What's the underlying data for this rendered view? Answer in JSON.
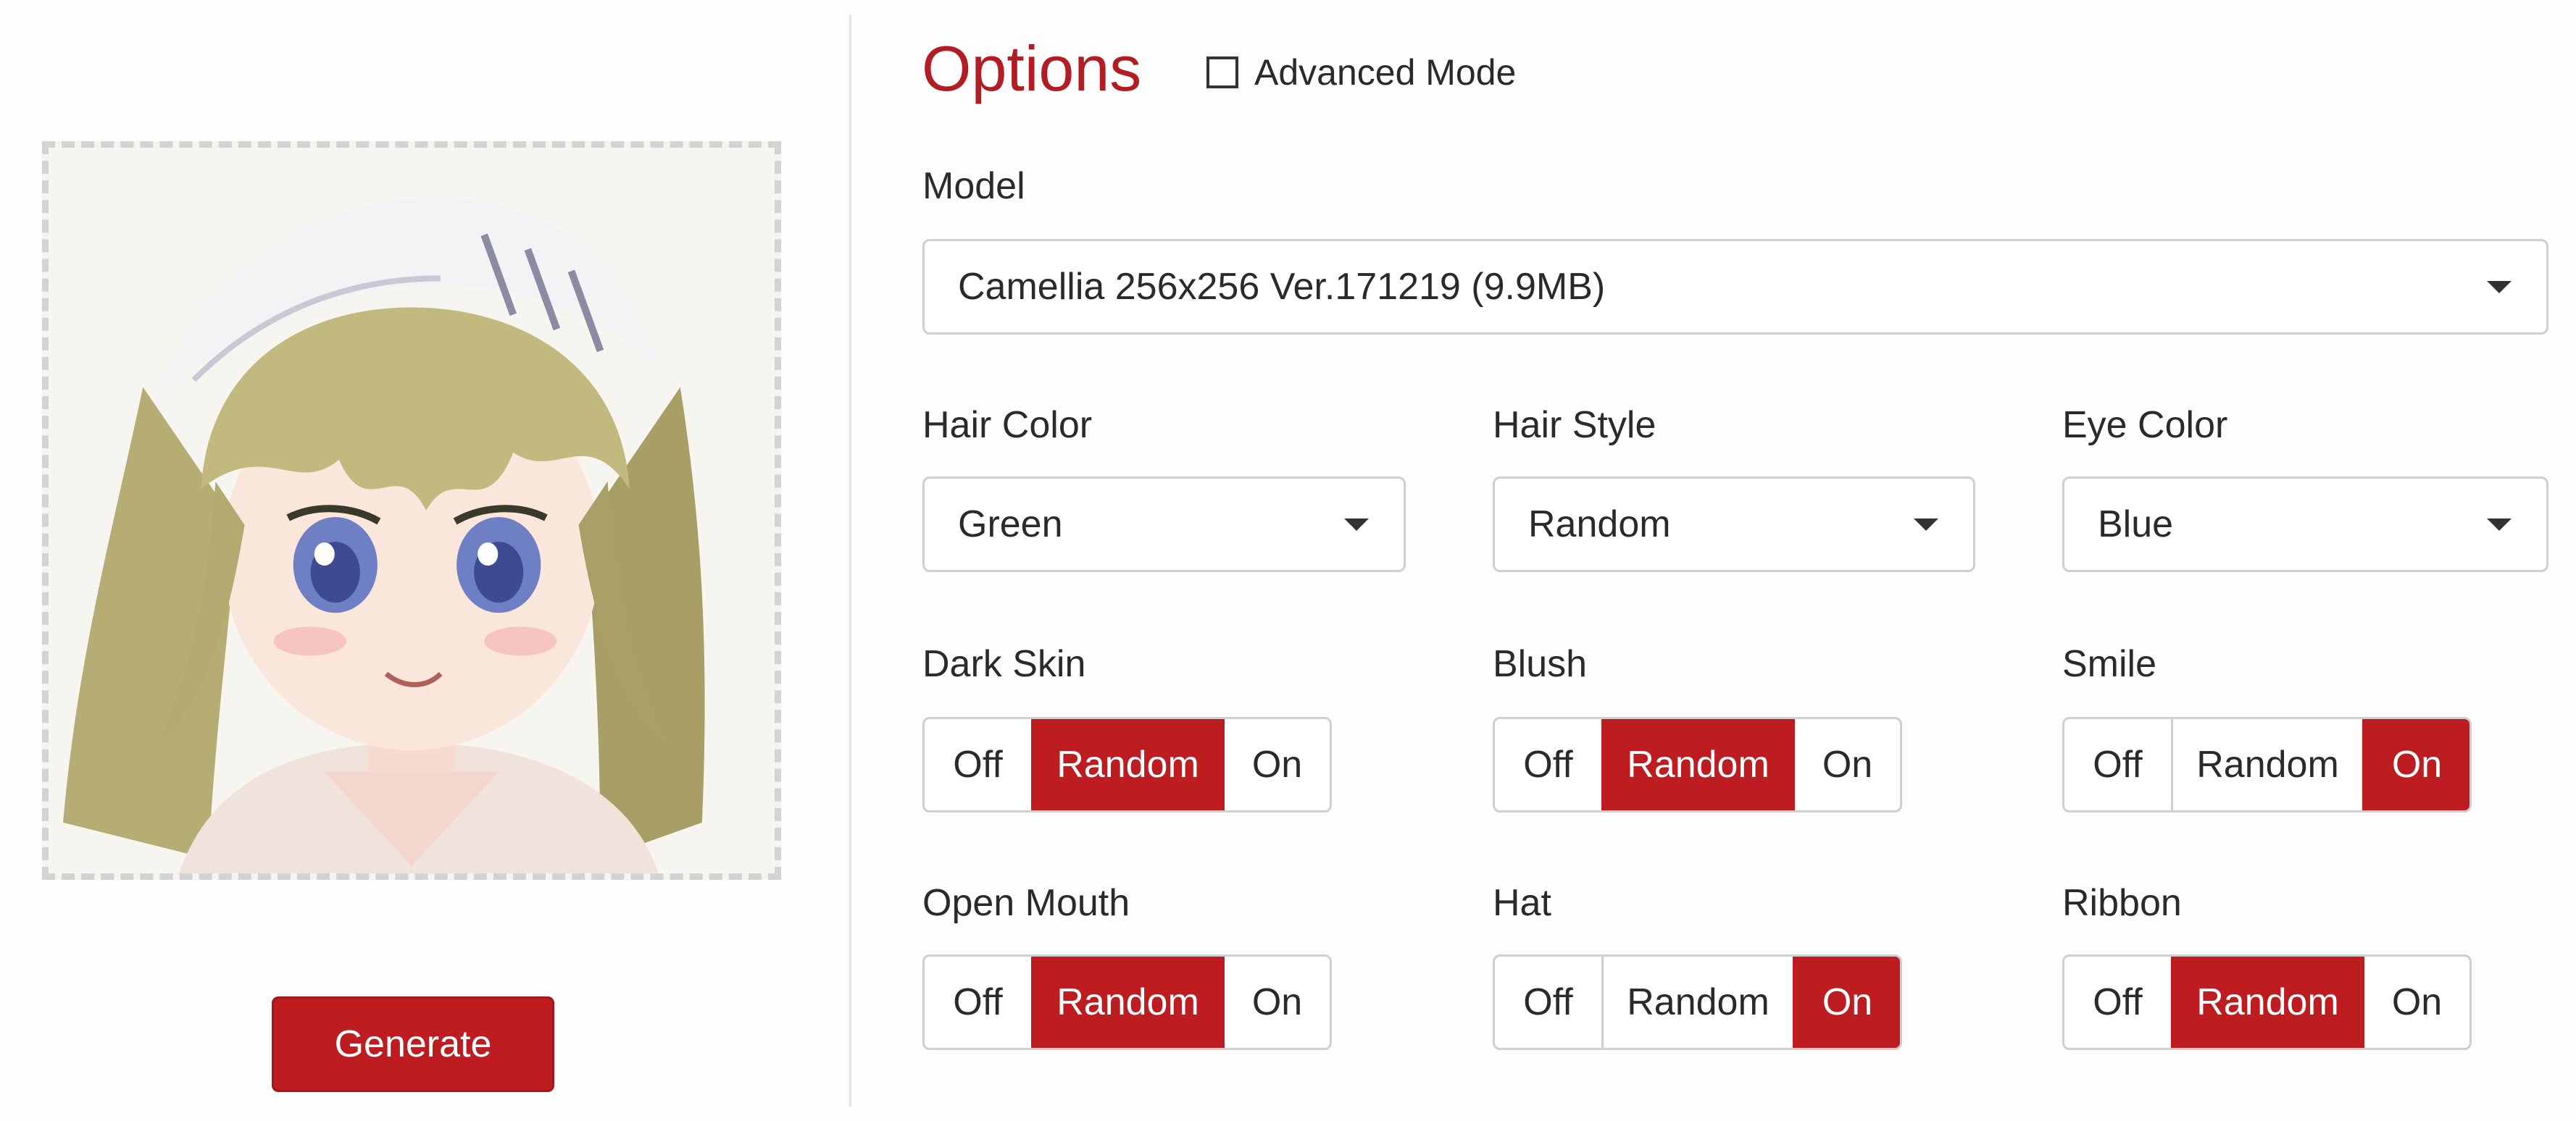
{
  "left_panel": {
    "generate_label": "Generate"
  },
  "options": {
    "title": "Options",
    "advanced_mode_label": "Advanced Mode",
    "advanced_mode_checked": false
  },
  "model": {
    "label": "Model",
    "selected": "Camellia 256x256 Ver.171219 (9.9MB)"
  },
  "selects": {
    "hair_color": {
      "label": "Hair Color",
      "value": "Green"
    },
    "hair_style": {
      "label": "Hair Style",
      "value": "Random"
    },
    "eye_color": {
      "label": "Eye Color",
      "value": "Blue"
    }
  },
  "toggle_labels": {
    "off": "Off",
    "random": "Random",
    "on": "On"
  },
  "toggles": {
    "dark_skin": {
      "label": "Dark Skin",
      "selected": "Random"
    },
    "blush": {
      "label": "Blush",
      "selected": "Random"
    },
    "smile": {
      "label": "Smile",
      "selected": "On"
    },
    "open_mouth": {
      "label": "Open Mouth",
      "selected": "Random"
    },
    "hat": {
      "label": "Hat",
      "selected": "On"
    },
    "ribbon": {
      "label": "Ribbon",
      "selected": "Random"
    }
  },
  "colors": {
    "accent": "#bd1c20",
    "title": "#b11d23",
    "border": "#cfcfcf"
  }
}
